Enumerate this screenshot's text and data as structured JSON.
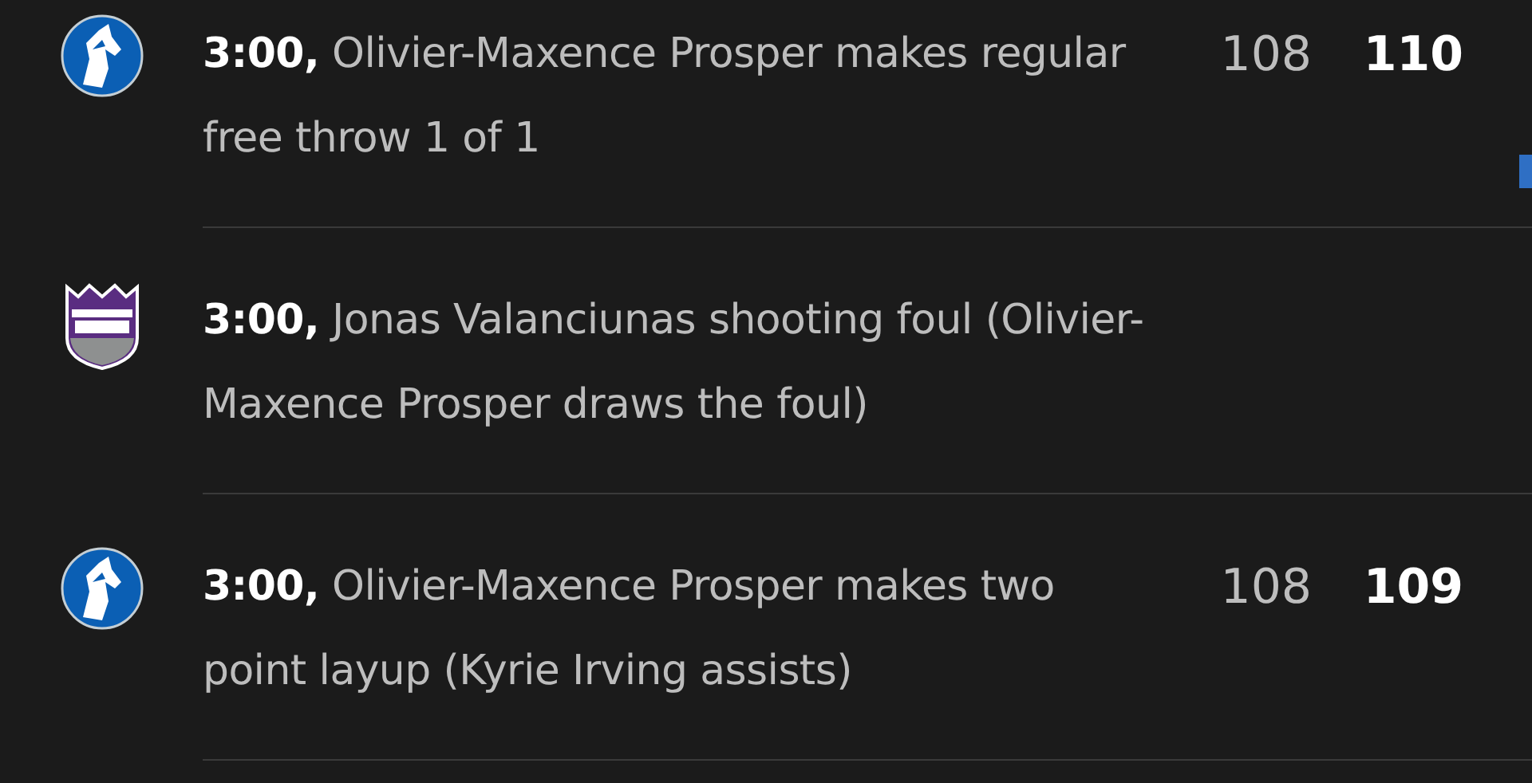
{
  "plays": [
    {
      "team": {
        "kind": "horse"
      },
      "time": "3:00,",
      "text": "Olivier-Maxence Prosper makes regular free throw 1 of 1",
      "score": {
        "away": "108",
        "home": "110"
      }
    },
    {
      "team": {
        "kind": "crown"
      },
      "time": "3:00,",
      "text": "Jonas Valanciunas shooting foul (Olivier-Maxence Prosper draws the foul)"
    },
    {
      "team": {
        "kind": "horse"
      },
      "time": "3:00,",
      "text": "Olivier-Maxence Prosper makes two point layup (Kyrie Irving assists)",
      "score": {
        "away": "108",
        "home": "109"
      }
    }
  ]
}
